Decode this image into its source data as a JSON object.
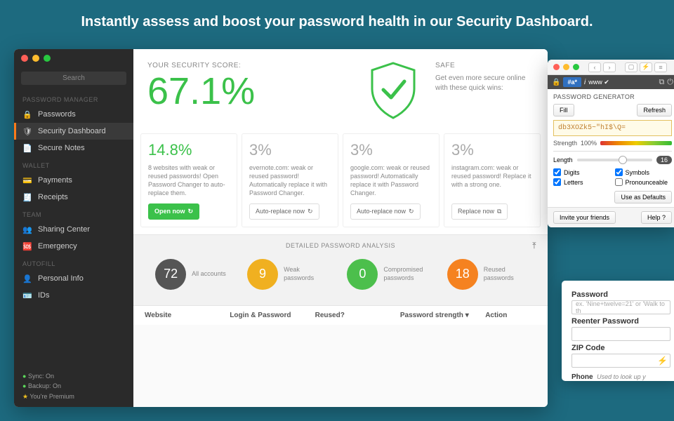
{
  "hero": "Instantly assess and boost your password health in our Security Dashboard.",
  "sidebar": {
    "search": "Search",
    "sections": [
      {
        "title": "PASSWORD MANAGER",
        "items": [
          {
            "icon": "lock-icon",
            "label": "Passwords"
          },
          {
            "icon": "shield-icon",
            "label": "Security Dashboard",
            "active": true
          },
          {
            "icon": "note-icon",
            "label": "Secure Notes"
          }
        ]
      },
      {
        "title": "WALLET",
        "items": [
          {
            "icon": "card-icon",
            "label": "Payments"
          },
          {
            "icon": "receipt-icon",
            "label": "Receipts"
          }
        ]
      },
      {
        "title": "TEAM",
        "items": [
          {
            "icon": "share-icon",
            "label": "Sharing Center"
          },
          {
            "icon": "emergency-icon",
            "label": "Emergency"
          }
        ]
      },
      {
        "title": "AUTOFILL",
        "items": [
          {
            "icon": "person-icon",
            "label": "Personal Info"
          },
          {
            "icon": "id-icon",
            "label": "IDs"
          }
        ]
      }
    ],
    "status": {
      "sync": "Sync: On",
      "backup": "Backup: On",
      "premium": "You're Premium"
    }
  },
  "score": {
    "label": "YOUR SECURITY SCORE:",
    "value": "67.1%",
    "safe_label": "SAFE",
    "safe_text": "Get even more secure online with these quick wins:"
  },
  "cards": [
    {
      "pct": "14.8%",
      "desc": "8 websites with weak or reused passwords! Open Password Changer to auto-replace them.",
      "btn": "Open now",
      "green": true
    },
    {
      "pct": "3%",
      "desc": "evernote.com: weak or reused password! Automatically replace it with Password Changer.",
      "btn": "Auto-replace now"
    },
    {
      "pct": "3%",
      "desc": "google.com: weak or reused password! Automatically replace it with Password Changer.",
      "btn": "Auto-replace now"
    },
    {
      "pct": "3%",
      "desc": "instagram.com: weak or reused password! Replace it with a strong one.",
      "btn": "Replace now"
    }
  ],
  "analysis": {
    "title": "DETAILED PASSWORD ANALYSIS",
    "circles": [
      {
        "val": "72",
        "label": "All accounts",
        "color": "#555"
      },
      {
        "val": "9",
        "label": "Weak passwords",
        "color": "#f0b020"
      },
      {
        "val": "0",
        "label": "Compromised passwords",
        "color": "#4cbf4c"
      },
      {
        "val": "18",
        "label": "Reused passwords",
        "color": "#f58220"
      }
    ],
    "columns": [
      "Website",
      "Login & Password",
      "Reused?",
      "Password strength",
      "Action"
    ]
  },
  "generator": {
    "title": "PASSWORD GENERATOR",
    "fill": "Fill",
    "refresh": "Refresh",
    "password": "db3XOZk5~\"hI$\\Q=",
    "strength_label": "Strength",
    "strength_val": "100%",
    "length_label": "Length",
    "length_val": "16",
    "opts": {
      "digits": "Digits",
      "symbols": "Symbols",
      "letters": "Letters",
      "pronounce": "Pronounceable"
    },
    "defaults": "Use as Defaults",
    "invite": "Invite your friends",
    "help": "Help",
    "tab": "#a*"
  },
  "form": {
    "pw": "Password",
    "pw_ph": "ex. 'Nine+twelve=21' or 'Walk to th",
    "rpw": "Reenter Password",
    "zip": "ZIP Code",
    "phone": "Phone",
    "phone_sub": "Used to look up y"
  },
  "colors": {
    "green": "#3bc14a",
    "orange": "#f58220",
    "yellow": "#f0b020",
    "dark": "#555"
  }
}
